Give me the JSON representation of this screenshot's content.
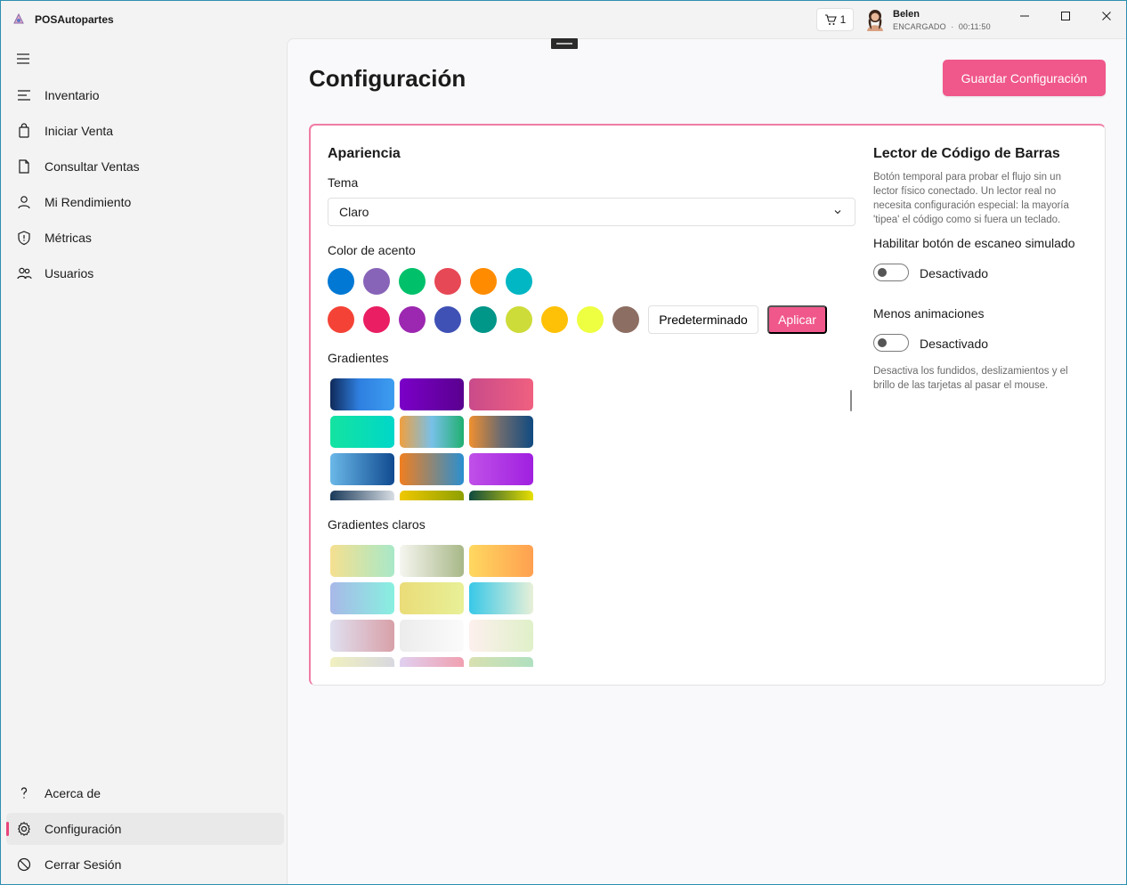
{
  "app": {
    "title": "POSAutopartes"
  },
  "header": {
    "cart_count": "1",
    "user_name": "Belen",
    "user_role": "ENCARGADO",
    "user_separator": "·",
    "session_time": "00:11:50"
  },
  "sidebar": {
    "items": [
      {
        "label": "Inventario",
        "icon": "inventory-icon"
      },
      {
        "label": "Iniciar Venta",
        "icon": "shopping-bag-icon"
      },
      {
        "label": "Consultar Ventas",
        "icon": "document-icon"
      },
      {
        "label": "Mi Rendimiento",
        "icon": "person-icon"
      },
      {
        "label": "Métricas",
        "icon": "shield-icon"
      },
      {
        "label": "Usuarios",
        "icon": "people-icon"
      }
    ],
    "footer": [
      {
        "label": "Acerca de",
        "icon": "question-icon"
      },
      {
        "label": "Configuración",
        "icon": "gear-icon",
        "active": true
      },
      {
        "label": "Cerrar Sesión",
        "icon": "sign-out-icon"
      }
    ]
  },
  "page": {
    "title": "Configuración",
    "save_label": "Guardar Configuración"
  },
  "appearance": {
    "title": "Apariencia",
    "theme_label": "Tema",
    "theme_value": "Claro",
    "accent_label": "Color de acento",
    "accent_colors_row1": [
      "#0078d4",
      "#8764b8",
      "#00c16a",
      "#e74856",
      "#ff8c00",
      "#00b7c3"
    ],
    "accent_colors_row2": [
      "#f44336",
      "#e91e63",
      "#9c27b0",
      "#3f51b5",
      "#009688",
      "#cddc39",
      "#ffc107",
      "#eeff41",
      "#8d6e63"
    ],
    "default_label": "Predeterminado",
    "apply_label": "Aplicar",
    "gradients_label": "Gradientes",
    "gradients": [
      "linear-gradient(90deg,#0f2a5a,#2f7fe0 45%,#3d9df0)",
      "linear-gradient(90deg,#7b00c8,#5a0090)",
      "linear-gradient(90deg,#c94b8a,#f06080)",
      "linear-gradient(90deg,#14e3a0,#00d7c8)",
      "linear-gradient(90deg,#f0a040,#78c0e8 50%,#20b070)",
      "linear-gradient(90deg,#f09030,#6a6a70 50%,#104a80)",
      "linear-gradient(90deg,#6ab8e8,#104a90)",
      "linear-gradient(90deg,#f07f20,#2a8fd0)",
      "linear-gradient(90deg,#c050e8,#a020e0)",
      "linear-gradient(90deg,#1a3a5a,#d8dde3)",
      "linear-gradient(90deg,#f0c800,#8ea000)",
      "linear-gradient(90deg,#0f4a40,#e8e000)"
    ],
    "light_gradients_label": "Gradientes claros",
    "light_gradients": [
      "linear-gradient(90deg,#f5e090,#a8e8c8)",
      "linear-gradient(90deg,#f6f6f0,#a8b888)",
      "linear-gradient(90deg,#ffd860,#ffa050)",
      "linear-gradient(90deg,#a8b8e8,#88f0e0)",
      "linear-gradient(90deg,#eadc78,#e8f098)",
      "linear-gradient(90deg,#38c8e8,#e8f0d8)",
      "linear-gradient(90deg,#e0e0f0,#d8a0a8)",
      "linear-gradient(90deg,#ececec,#fbfbfb)",
      "linear-gradient(90deg,#fdf0ee,#dff0c8)",
      "linear-gradient(90deg,#f0f0c0,#d8d8e0)",
      "linear-gradient(90deg,#e0d0f0,#f0a0b0)",
      "linear-gradient(90deg,#d8e0b0,#b0e0c0)"
    ]
  },
  "barcode": {
    "title": "Lector de Código de Barras",
    "description": "Botón temporal para probar el flujo sin un lector físico conectado. Un lector real no necesita configuración especial: la mayoría 'tipea' el código como si fuera un teclado.",
    "simulate_label": "Habilitar botón de escaneo simulado",
    "simulate_state": "Desactivado",
    "reduce_motion_label": "Menos animaciones",
    "reduce_motion_state": "Desactivado",
    "reduce_motion_desc": "Desactiva los fundidos, deslizamientos y el brillo de las tarjetas al pasar el mouse."
  }
}
